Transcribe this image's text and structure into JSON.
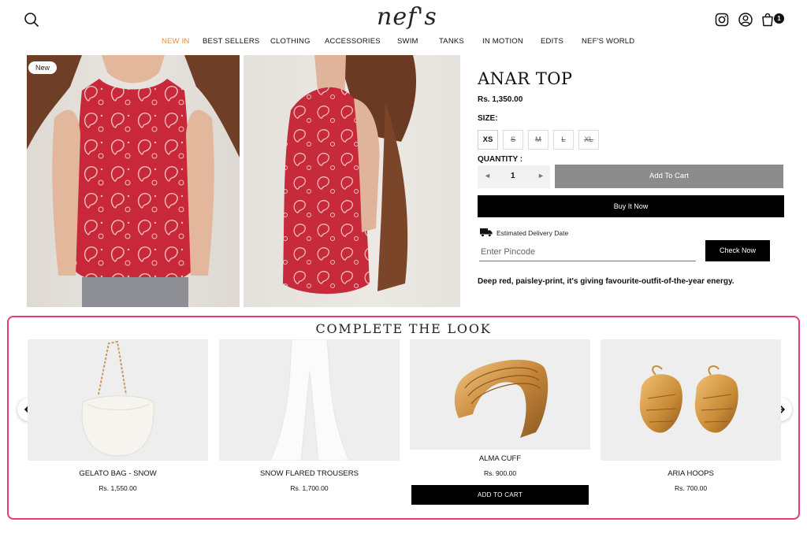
{
  "header": {
    "logo": "nef's",
    "cart_count": "1",
    "nav": [
      {
        "label": "NEW IN",
        "active": true
      },
      {
        "label": "BEST SELLERS"
      },
      {
        "label": "CLOTHING"
      },
      {
        "label": "ACCESSORIES"
      },
      {
        "label": "SWIM"
      },
      {
        "label": "TANKS"
      },
      {
        "label": "IN MOTION"
      },
      {
        "label": "EDITS"
      },
      {
        "label": "NEF'S WORLD"
      }
    ]
  },
  "product": {
    "badge": "New",
    "title": "ANAR TOP",
    "price": "Rs. 1,350.00",
    "size_label": "SIZE:",
    "sizes": [
      "XS",
      "S",
      "M",
      "L",
      "XL"
    ],
    "quantity_label": "QUANTITY :",
    "quantity": "1",
    "qty_decrease": "◄",
    "qty_increase": "►",
    "add_to_cart": "Add To Cart",
    "buy_now": "Buy It Now",
    "delivery_label": "Estimated Delivery Date",
    "pincode_placeholder": "Enter Pincode",
    "check_now": "Check Now",
    "description": "Deep red, paisley-print, it's giving favourite-outfit-of-the-year energy."
  },
  "complete_the_look": {
    "heading": "COMPLETE THE LOOK",
    "items": [
      {
        "name": "GELATO BAG - SNOW",
        "price": "Rs. 1,550.00"
      },
      {
        "name": "SNOW FLARED TROUSERS",
        "price": "Rs. 1,700.00"
      },
      {
        "name": "ALMA CUFF",
        "price": "Rs. 900.00",
        "button": "ADD TO CART"
      },
      {
        "name": "ARIA HOOPS",
        "price": "Rs. 700.00"
      }
    ]
  },
  "colors": {
    "accent_nav": "#e0913c",
    "highlight_frame": "#e83c6e",
    "primary_button": "#000000",
    "disabled_button": "#8c8c8c"
  }
}
